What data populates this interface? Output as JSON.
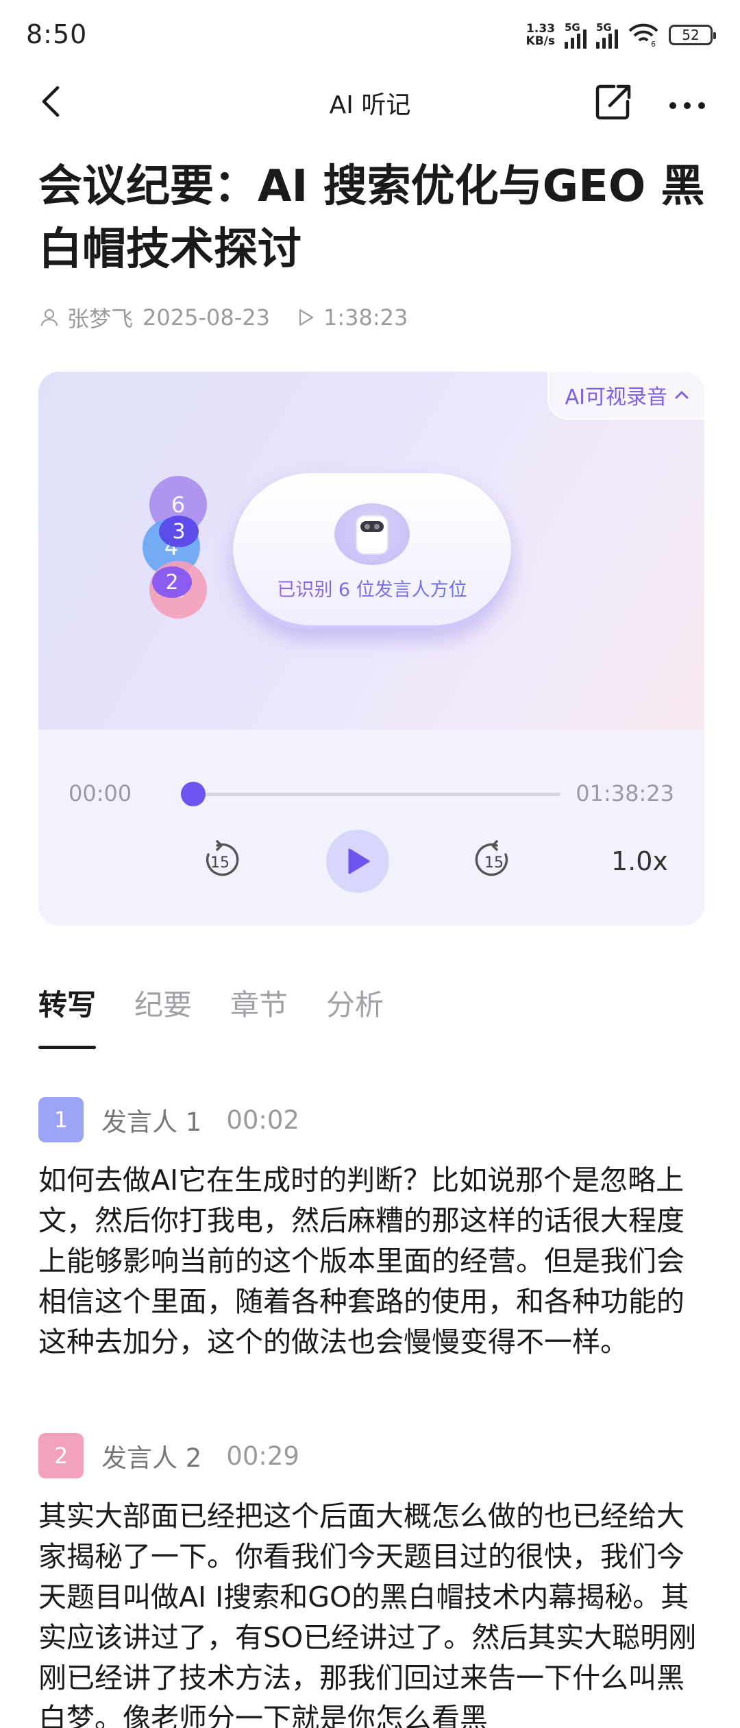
{
  "status_bar": {
    "time": "8:50",
    "net_speed_value": "1.33",
    "net_speed_unit": "KB/s",
    "signal1_label": "5G",
    "signal2_label": "5G",
    "wifi_label": "6",
    "battery": "52"
  },
  "nav": {
    "title": "AI 听记",
    "icons": [
      "back-icon",
      "share-icon",
      "more-icon"
    ]
  },
  "document": {
    "title": "会议纪要：AI 搜索优化与GEO 黑白帽技术探讨",
    "author": "张梦飞",
    "date": "2025-08-23",
    "duration": "1:38:23"
  },
  "visual": {
    "badge_label": "AI可视录音",
    "identified_text": "已识别 6 位发言人方位",
    "speaker_dots": [
      {
        "number": "6",
        "color": "#a98ff0"
      },
      {
        "number": "4",
        "color": "#6aa8f5"
      },
      {
        "number": "2",
        "color": "#f3a1bb"
      },
      {
        "number": "3",
        "color": "#5d4bea"
      },
      {
        "number": "2",
        "color": "#8c5cf0"
      }
    ]
  },
  "player": {
    "current_time": "00:00",
    "total_time": "01:38:23",
    "progress": 0,
    "rewind_seconds": "15",
    "forward_seconds": "15",
    "speed": "1.0x",
    "accent_color": "#6f54ef"
  },
  "tabs": [
    {
      "label": "转写",
      "active": true
    },
    {
      "label": "纪要",
      "active": false
    },
    {
      "label": "章节",
      "active": false
    },
    {
      "label": "分析",
      "active": false
    }
  ],
  "transcript": [
    {
      "speaker_number": "1",
      "speaker_name": "发言人 1",
      "timestamp": "00:02",
      "color": "#9aa3f5",
      "text": "如何去做AI它在生成时的判断？比如说那个是忽略上文，然后你打我电，然后麻糟的那这样的话很大程度上能够影响当前的这个版本里面的经营。但是我们会相信这个里面，随着各种套路的使用，和各种功能的这种去加分，这个的做法也会慢慢变得不一样。"
    },
    {
      "speaker_number": "2",
      "speaker_name": "发言人 2",
      "timestamp": "00:29",
      "color": "#f3a1bb",
      "text": "其实大部面已经把这个后面大概怎么做的也已经给大家揭秘了一下。你看我们今天题目过的很快，我们今天题目叫做AI I搜索和GO的黑白帽技术内幕揭秘。其实应该讲过了，有SO已经讲过了。然后其实大聪明刚刚已经讲了技术方法，那我们回过来告一下什么叫黑白梦。像老师分一下就是你怎么看黑"
    }
  ]
}
